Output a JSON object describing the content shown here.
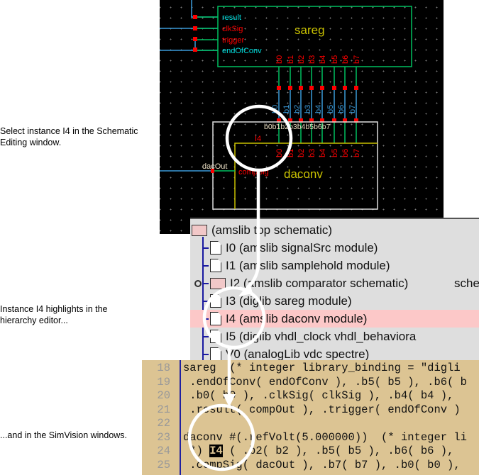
{
  "captions": [
    "Select instance I4 in the Schematic Editing window.",
    "Instance I4 highlights in the hierarchy editor...",
    "...and in the SimVision windows."
  ],
  "schematic": {
    "sareg": {
      "name": "sareg",
      "pins": [
        "result",
        "clkSig",
        "trigger",
        "endOfConv"
      ],
      "outputs": [
        "b0",
        "b1",
        "b2",
        "b3",
        "b4",
        "b5",
        "b6",
        "b7"
      ]
    },
    "wires": [
      "b0",
      "b1",
      "b2",
      "b3",
      "b4",
      "b5",
      "b6",
      "b7"
    ],
    "daconv": {
      "name": "daconv",
      "instance": "I4",
      "inputs": [
        "b0",
        "b1",
        "b2",
        "b3",
        "b4",
        "b5",
        "b6",
        "b7"
      ],
      "top_pins": "b0b1b2b3b4b5b6b7",
      "pin": "compSig",
      "net": "dacOut"
    },
    "colors": {
      "pin_cyan": "#00e0e0",
      "pin_red": "#ff0000",
      "box_green": "#00c060",
      "label_yellow": "#c8c000"
    }
  },
  "hierarchy": {
    "items": [
      {
        "label": "(amslib top schematic)",
        "type": "folder"
      },
      {
        "label": "I0 (amslib signalSrc module)",
        "type": "doc"
      },
      {
        "label": "I1 (amslib samplehold module)",
        "type": "doc"
      },
      {
        "label": "I2 (amslib comparator schematic)",
        "type": "folder",
        "extra": "sche"
      },
      {
        "label": "I3 (diglib sareg module)",
        "type": "doc"
      },
      {
        "label": "I4 (amslib daconv module)",
        "type": "doc",
        "selected": true
      },
      {
        "label": "I5 (diglib vhdl_clock vhdl_behaviora",
        "type": "doc"
      },
      {
        "label": "V0 (analogLib vdc spectre)",
        "type": "doc"
      }
    ]
  },
  "source": {
    "lines": [
      {
        "n": "18",
        "pre": "sareg  (* integer library_binding = \"digli",
        "hl": "",
        "post": ""
      },
      {
        "n": "19",
        "pre": " .endOfConv( endOfConv ), .b5( b5 ), .b6( b",
        "hl": "",
        "post": ""
      },
      {
        "n": "20",
        "pre": " .b0( b0 ), .clkSig( clkSig ), .b4( b4 ),",
        "hl": "",
        "post": ""
      },
      {
        "n": "21",
        "pre": " .result( compOut ), .trigger( endOfConv )",
        "hl": "",
        "post": ""
      },
      {
        "n": "22",
        "pre": "",
        "hl": "",
        "post": ""
      },
      {
        "n": "23",
        "pre": "daconv #(.refVolt(5.000000))  (* integer li",
        "hl": "",
        "post": ""
      },
      {
        "n": "24",
        "pre": " *) ",
        "hl": "I4",
        "post": " ( .b2( b2 ), .b5( b5 ), .b6( b6 ),"
      },
      {
        "n": "25",
        "pre": " .compSig( dacOut ), .b7( b7 ), .b0( b0 ),",
        "hl": "",
        "post": ""
      }
    ]
  }
}
